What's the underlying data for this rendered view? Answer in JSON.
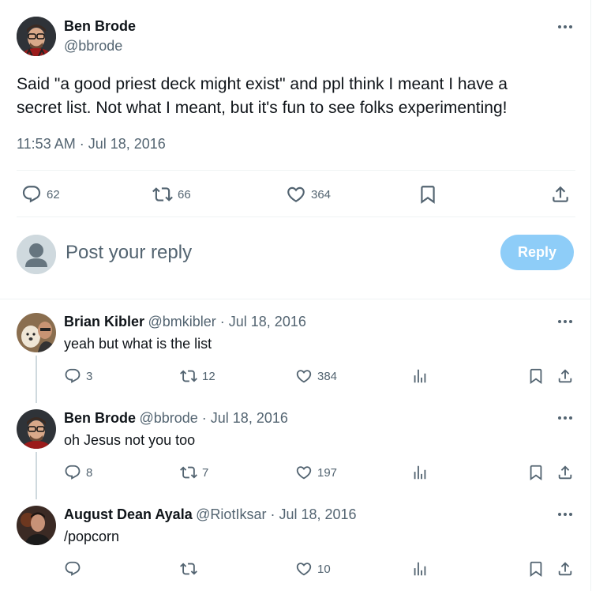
{
  "main_tweet": {
    "author_name": "Ben Brode",
    "author_handle": "@bbrode",
    "text_line1": "Said \"a good priest deck might exist\" and ppl think I meant I have a",
    "text_line2": "secret list. Not what I meant, but it's fun to see folks experimenting!",
    "timestamp": "11:53 AM · Jul 18, 2016",
    "replies": "62",
    "retweets": "66",
    "likes": "364"
  },
  "composer": {
    "placeholder": "Post your reply",
    "button_label": "Reply"
  },
  "replies": [
    {
      "author_name": "Brian Kibler",
      "meta": "@bmkibler · Jul 18, 2016",
      "text": "yeah but what is the list",
      "replies": "3",
      "retweets": "12",
      "likes": "384"
    },
    {
      "author_name": "Ben Brode",
      "meta": "@bbrode · Jul 18, 2016",
      "text": "oh Jesus not you too",
      "replies": "8",
      "retweets": "7",
      "likes": "197"
    },
    {
      "author_name": "August Dean Ayala",
      "meta": "@RiotIksar · Jul 18, 2016",
      "text": "/popcorn",
      "replies": "",
      "retweets": "",
      "likes": "10"
    }
  ],
  "icons": {
    "reply": "reply-icon",
    "retweet": "retweet-icon",
    "like": "heart-icon",
    "bookmark": "bookmark-icon",
    "share": "share-icon",
    "views": "views-icon",
    "more": "more-icon"
  },
  "colors": {
    "text": "#0f1419",
    "secondary": "#536471",
    "reply_button": "#8ecdf8",
    "divider": "#eff3f4"
  }
}
